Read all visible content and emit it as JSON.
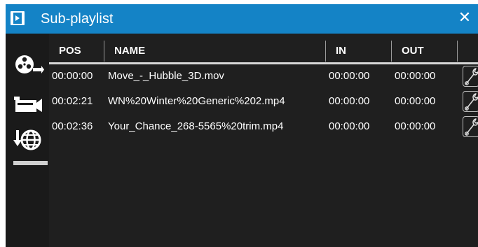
{
  "window": {
    "title": "Sub-playlist",
    "close_glyph": "✕",
    "icons": {
      "app": "playlist-film-icon",
      "close": "close-icon"
    },
    "colors": {
      "titlebar": "#1483c6",
      "background": "#1f1f1f",
      "text": "#ffffff"
    }
  },
  "sidebar": {
    "items": [
      {
        "name": "film-reel-icon"
      },
      {
        "name": "video-camera-icon"
      },
      {
        "name": "globe-download-icon"
      }
    ]
  },
  "table": {
    "columns": [
      "POS",
      "NAME",
      "IN",
      "OUT",
      ""
    ],
    "rows": [
      {
        "pos": "00:00:00",
        "name": "Move_-_Hubble_3D.mov",
        "in": "00:00:00",
        "out": "00:00:00",
        "action_icon": "wrench-icon"
      },
      {
        "pos": "00:02:21",
        "name": "WN%20Winter%20Generic%202.mp4",
        "in": "00:00:00",
        "out": "00:00:00",
        "action_icon": "wrench-icon"
      },
      {
        "pos": "00:02:36",
        "name": "Your_Chance_268-5565%20trim.mp4",
        "in": "00:00:00",
        "out": "00:00:00",
        "action_icon": "wrench-icon"
      }
    ]
  }
}
